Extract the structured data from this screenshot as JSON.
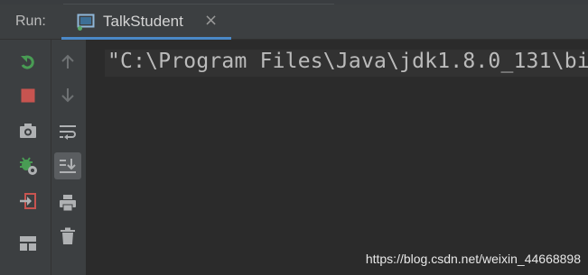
{
  "window": {
    "run_label": "Run:",
    "tab_title": "TalkStudent",
    "tab_close": "×"
  },
  "toolbar_left": [
    {
      "name": "rerun",
      "icon": "rerun-icon"
    },
    {
      "name": "stop",
      "icon": "stop-icon"
    },
    {
      "name": "dump-threads",
      "icon": "camera-icon"
    },
    {
      "name": "debug-settings",
      "icon": "bug-settings-icon"
    },
    {
      "name": "exit",
      "icon": "exit-icon"
    },
    {
      "name": "restore-layout",
      "icon": "layout-icon"
    }
  ],
  "toolbar_right": [
    {
      "name": "up-stack-trace",
      "icon": "arrow-up-icon"
    },
    {
      "name": "down-stack-trace",
      "icon": "arrow-down-icon"
    },
    {
      "name": "soft-wraps",
      "icon": "wrap-icon"
    },
    {
      "name": "scroll-to-end",
      "icon": "scroll-to-end-icon",
      "pressed": true
    },
    {
      "name": "print",
      "icon": "printer-icon"
    },
    {
      "name": "clear-all",
      "icon": "trash-icon"
    }
  ],
  "console": {
    "line1": "\"C:\\Program Files\\Java\\jdk1.8.0_131\\bi"
  },
  "watermark": "https://blog.csdn.net/weixin_44668898",
  "colors": {
    "accent": "#4a88c7",
    "rerun_green": "#499c54",
    "stop_red": "#c75450",
    "icon_gray": "#afb1b3"
  }
}
